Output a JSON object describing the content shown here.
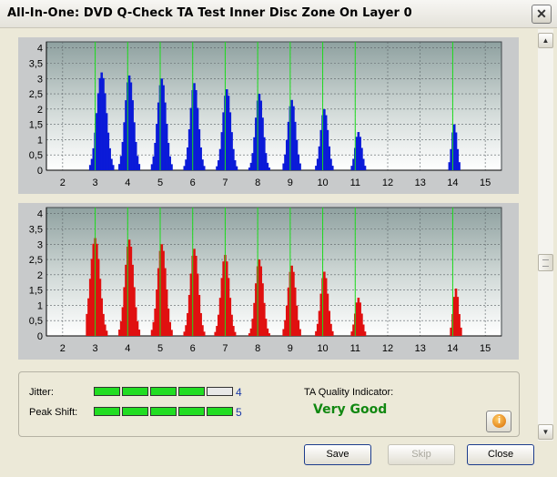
{
  "window": {
    "title": "All-In-One: DVD Q-Check TA Test Inner Disc Zone On Layer 0",
    "close_glyph": "✕"
  },
  "chart_data": [
    {
      "type": "bar",
      "xlim": [
        1.5,
        15.5
      ],
      "ylim": [
        0,
        4.2
      ],
      "x_ticks": [
        "2",
        "3",
        "4",
        "5",
        "6",
        "7",
        "8",
        "9",
        "10",
        "11",
        "12",
        "13",
        "14",
        "15"
      ],
      "y_ticks": [
        "0",
        "0,5",
        "1",
        "1,5",
        "2",
        "2,5",
        "3",
        "3,5",
        "4"
      ],
      "reference_lines_x": [
        3,
        4,
        5,
        6,
        7,
        8,
        9,
        10,
        11,
        14
      ],
      "grid": true,
      "bar_color": "#0b1bd8",
      "peaks": [
        {
          "center": 3.2,
          "height": 3.2,
          "width": 0.45
        },
        {
          "center": 4.05,
          "height": 3.1,
          "width": 0.4
        },
        {
          "center": 5.05,
          "height": 3.0,
          "width": 0.4
        },
        {
          "center": 6.05,
          "height": 2.85,
          "width": 0.38
        },
        {
          "center": 7.05,
          "height": 2.65,
          "width": 0.38
        },
        {
          "center": 8.05,
          "height": 2.5,
          "width": 0.36
        },
        {
          "center": 9.05,
          "height": 2.3,
          "width": 0.36
        },
        {
          "center": 10.05,
          "height": 2.0,
          "width": 0.34
        },
        {
          "center": 11.1,
          "height": 1.25,
          "width": 0.3
        },
        {
          "center": 14.05,
          "height": 1.5,
          "width": 0.25
        }
      ]
    },
    {
      "type": "bar",
      "xlim": [
        1.5,
        15.5
      ],
      "ylim": [
        0,
        4.2
      ],
      "x_ticks": [
        "2",
        "3",
        "4",
        "5",
        "6",
        "7",
        "8",
        "9",
        "10",
        "11",
        "12",
        "13",
        "14",
        "15"
      ],
      "y_ticks": [
        "0",
        "0,5",
        "1",
        "1,5",
        "2",
        "2,5",
        "3",
        "3,5",
        "4"
      ],
      "reference_lines_x": [
        3,
        4,
        5,
        6,
        7,
        8,
        9,
        10,
        11,
        14
      ],
      "grid": true,
      "bar_color": "#e01010",
      "peaks": [
        {
          "center": 3.0,
          "height": 3.2,
          "width": 0.45
        },
        {
          "center": 4.05,
          "height": 3.15,
          "width": 0.4
        },
        {
          "center": 5.05,
          "height": 3.0,
          "width": 0.4
        },
        {
          "center": 6.05,
          "height": 2.85,
          "width": 0.38
        },
        {
          "center": 7.0,
          "height": 2.65,
          "width": 0.38
        },
        {
          "center": 8.05,
          "height": 2.5,
          "width": 0.36
        },
        {
          "center": 9.05,
          "height": 2.3,
          "width": 0.36
        },
        {
          "center": 10.05,
          "height": 2.1,
          "width": 0.34
        },
        {
          "center": 11.1,
          "height": 1.25,
          "width": 0.3
        },
        {
          "center": 14.1,
          "height": 1.55,
          "width": 0.25
        }
      ]
    }
  ],
  "quality": {
    "jitter_label": "Jitter:",
    "jitter_value": "4",
    "jitter_level": 4,
    "peak_shift_label": "Peak Shift:",
    "peak_shift_value": "5",
    "peak_shift_level": 5,
    "max_level": 5,
    "ta_label": "TA Quality Indicator:",
    "ta_value": "Very Good",
    "info_glyph": "i"
  },
  "buttons": {
    "save": "Save",
    "skip": "Skip",
    "close": "Close"
  },
  "scrollbar": {
    "up_glyph": "▲",
    "down_glyph": "▼"
  }
}
